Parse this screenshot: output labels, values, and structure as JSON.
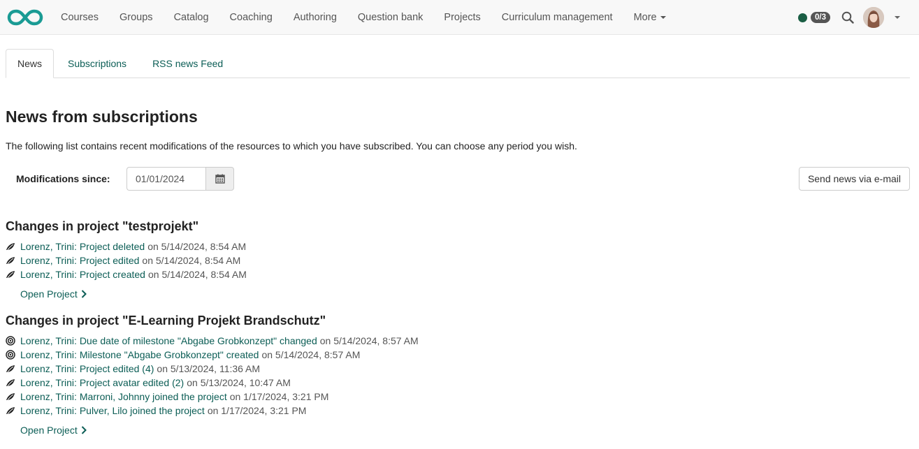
{
  "nav": {
    "items": [
      "Courses",
      "Groups",
      "Catalog",
      "Coaching",
      "Authoring",
      "Question bank",
      "Projects",
      "Curriculum management"
    ],
    "more_label": "More",
    "badge": "0/3",
    "brand_color": "#1a9b94",
    "status_color": "#1a5e44"
  },
  "tabs": [
    {
      "label": "News",
      "active": true
    },
    {
      "label": "Subscriptions",
      "active": false
    },
    {
      "label": "RSS news Feed",
      "active": false
    }
  ],
  "page": {
    "title": "News from subscriptions",
    "intro": "The following list contains recent modifications of the resources to which you have subscribed. You can choose any period you wish."
  },
  "filter": {
    "label": "Modifications since:",
    "date_value": "01/01/2024",
    "send_label": "Send news via e-mail"
  },
  "sections": [
    {
      "title": "Changes in project \"testprojekt\"",
      "entries": [
        {
          "icon": "project-icon",
          "link": "Lorenz, Trini: Project deleted",
          "time": "on 5/14/2024, 8:54 AM"
        },
        {
          "icon": "project-icon",
          "link": "Lorenz, Trini: Project edited",
          "time": "on 5/14/2024, 8:54 AM"
        },
        {
          "icon": "project-icon",
          "link": "Lorenz, Trini: Project created",
          "time": "on 5/14/2024, 8:54 AM"
        }
      ],
      "open_label": "Open Project"
    },
    {
      "title": "Changes in project \"E-Learning Projekt Brandschutz\"",
      "entries": [
        {
          "icon": "milestone-icon",
          "link": "Lorenz, Trini: Due date of milestone \"Abgabe Grobkonzept\" changed",
          "time": "on 5/14/2024, 8:57 AM"
        },
        {
          "icon": "milestone-icon",
          "link": "Lorenz, Trini: Milestone \"Abgabe Grobkonzept\" created",
          "time": "on 5/14/2024, 8:57 AM"
        },
        {
          "icon": "project-icon",
          "link": "Lorenz, Trini: Project edited (4)",
          "time": "on 5/13/2024, 11:36 AM"
        },
        {
          "icon": "project-icon",
          "link": "Lorenz, Trini: Project avatar edited (2)",
          "time": "on 5/13/2024, 10:47 AM"
        },
        {
          "icon": "project-icon",
          "link": "Lorenz, Trini: Marroni, Johnny joined the project",
          "time": "on 1/17/2024, 3:21 PM"
        },
        {
          "icon": "project-icon",
          "link": "Lorenz, Trini: Pulver, Lilo joined the project",
          "time": "on 1/17/2024, 3:21 PM"
        }
      ],
      "open_label": "Open Project"
    }
  ]
}
